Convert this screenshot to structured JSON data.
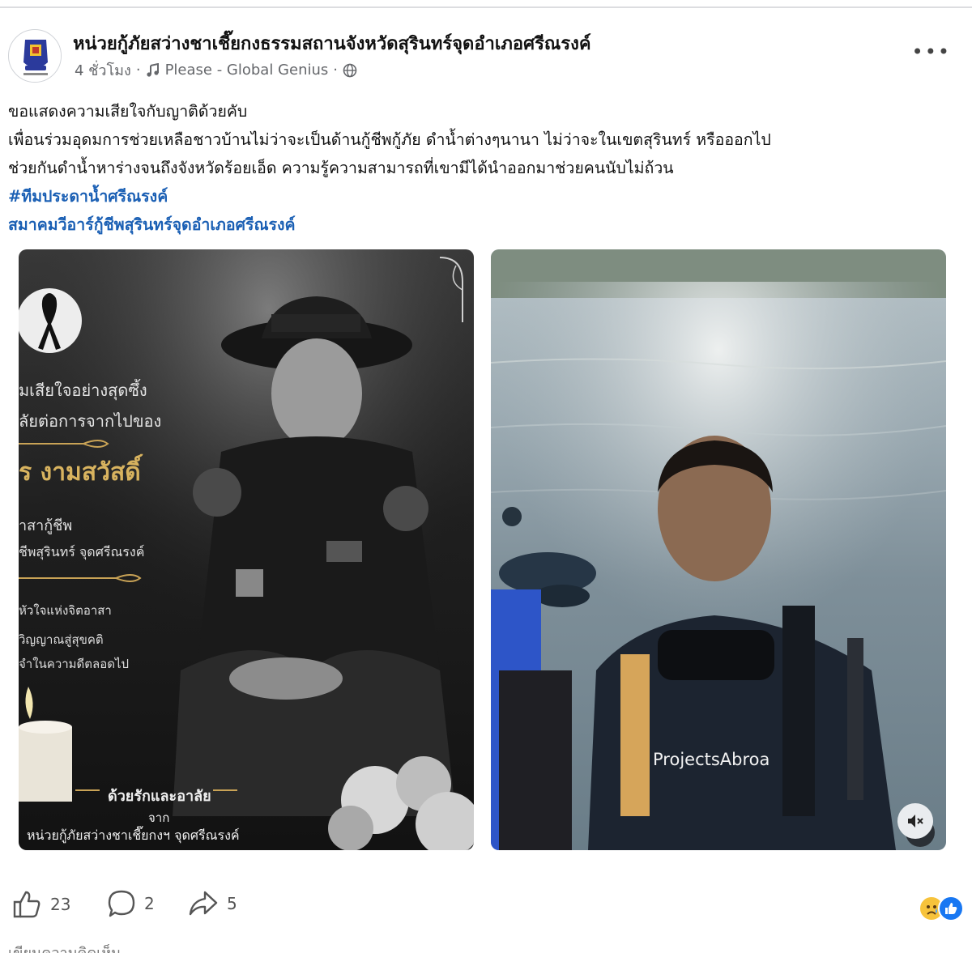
{
  "post": {
    "page_name": "หน่วยกู้ภัยสว่างชาเชี๊ยกงธรรมสถานจังหวัดสุรินทร์จุดอำเภอศรีณรงค์",
    "time": "4 ชั่วโมง",
    "separator": "·",
    "music_track": "Please - Global Genius",
    "privacy_icon": "globe-icon",
    "more_label": "•••",
    "text_lines": [
      "ขอแสดงความเสียใจกับญาติด้วยคับ",
      "เพื่อนร่วมอุดมการช่วยเหลือชาวบ้านไม่ว่าจะเป็นด้านกู้ชีพกู้ภัย ดำน้ำต่างๆนานา ไม่ว่าจะในเขตสุรินทร์ หรือออกไป",
      "ช่วยกันดำน้ำหาร่างจนถึงจังหวัดร้อยเอ็ด ความรู้ความสามารถที่เขามีได้นำออกมาช่วยคนนับไม่ถ้วน"
    ],
    "hashtags": [
      "#ทีมประดาน้ำศรีณรงค์",
      "สมาคมวีอาร์กู้ชีพสุรินทร์จุดอำเภอศรีณรงค์"
    ]
  },
  "photo_left": {
    "lines": [
      "มเสียใจอย่างสุดซึ้ง",
      "ลัยต่อการจากไปของ",
      "ร งามสวัสดิ์",
      "าสากู้ชีพ",
      "ชีพสุรินทร์ จุดศรีณรงค์",
      "หัวใจแห่งจิตอาสา",
      "วิญญาณสู่สุขคติ",
      "จำในความดีตลอดไป",
      "ด้วยรักและอาลัย",
      "จาก",
      "หน่วยกู้ภัยสว่างชาเชี๊ยกงฯ จุดศรีณรงค์"
    ]
  },
  "photo_right": {
    "shirt_text": "ProjectsAbroa",
    "mute_icon": "speaker-muted-icon"
  },
  "reactions": {
    "likes": "23",
    "comments": "2",
    "shares": "5"
  },
  "footer_partial": "เขียนความคิดเห็น"
}
